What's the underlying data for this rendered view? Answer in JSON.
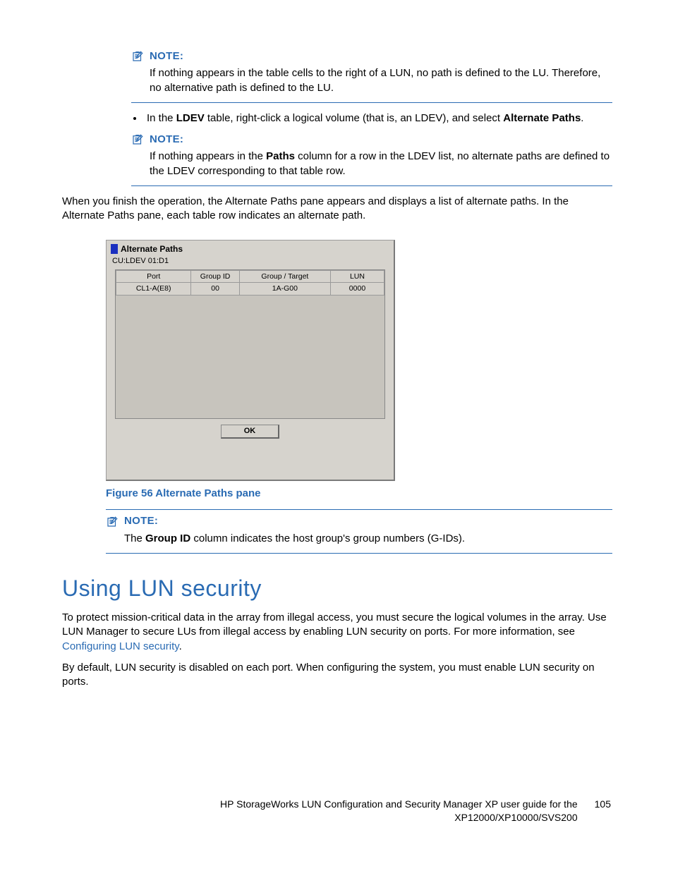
{
  "notes": {
    "label": "NOTE:",
    "note1_text": "If nothing appears in the table cells to the right of a LUN, no path is defined to the LU. Therefore, no alternative path is defined to the LU.",
    "note2_text_pre": "If nothing appears in the ",
    "note2_bold": "Paths",
    "note2_text_post": " column for a row in the LDEV list, no alternate paths are defined to the LDEV corresponding to that table row.",
    "note3_pre": "The ",
    "note3_bold": "Group ID",
    "note3_post": " column indicates the host group's group numbers (G-IDs)."
  },
  "bullet": {
    "pre": "In the ",
    "b1": "LDEV",
    "mid": " table, right-click a logical volume (that is, an LDEV), and select ",
    "b2": "Alternate Paths",
    "post": "."
  },
  "after_note2": "When you finish the operation, the Alternate Paths pane appears and displays a list of alternate paths. In the Alternate Paths pane, each table row indicates an alternate path.",
  "pane": {
    "title": "Alternate Paths",
    "subtitle": "CU:LDEV 01:D1",
    "headers": {
      "port": "Port",
      "gid": "Group ID",
      "gt": "Group / Target",
      "lun": "LUN"
    },
    "row": {
      "port": "CL1-A(E8)",
      "gid": "00",
      "gt": "1A-G00",
      "lun": "0000"
    },
    "ok": "OK"
  },
  "figure_caption": "Figure 56 Alternate Paths pane",
  "section": {
    "heading": "Using LUN security",
    "p1_pre": "To protect mission-critical data in the array from illegal access, you must secure the logical volumes in the array. Use LUN Manager to secure LUs from illegal access by enabling LUN security on ports. For more information, see ",
    "p1_link": "Configuring LUN security",
    "p1_post": ".",
    "p2": "By default, LUN security is disabled on each port. When configuring the system, you must enable LUN security on ports."
  },
  "footer": {
    "line1": "HP StorageWorks LUN Configuration and Security Manager XP user guide for the",
    "line2": "XP12000/XP10000/SVS200",
    "page": "105"
  }
}
